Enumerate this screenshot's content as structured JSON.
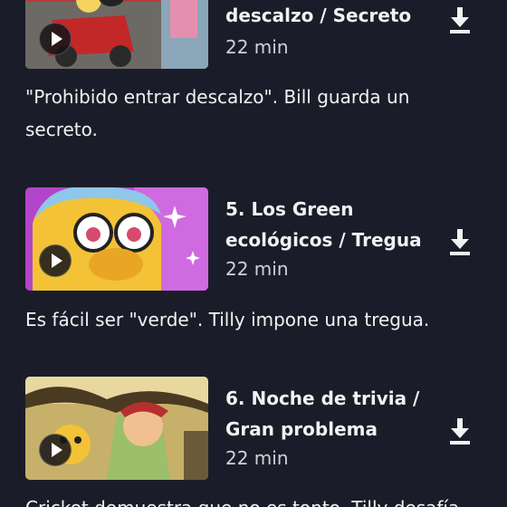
{
  "episodes": [
    {
      "title": "descalzo / Secreto",
      "duration": "22 min",
      "description": "\"Prohibido entrar descalzo\". Bill guarda un secreto."
    },
    {
      "title": "5. Los Green ecológicos / Tregua",
      "duration": "22 min",
      "description": "Es fácil ser \"verde\". Tilly impone una tregua."
    },
    {
      "title": "6. Noche de trivia / Gran problema",
      "duration": "22 min",
      "description": "Cricket demuestra que no es tonto. Tilly desafía"
    }
  ],
  "icons": {
    "play": "play-icon",
    "download": "download-icon"
  },
  "colors": {
    "background": "#1a1d29",
    "text": "#f2f2f2",
    "muted": "#d0d2d8"
  }
}
